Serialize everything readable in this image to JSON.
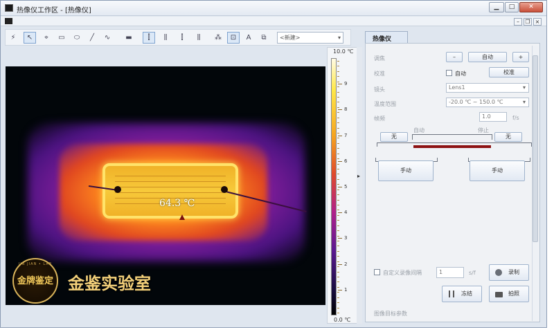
{
  "window": {
    "title": "热像仪工作区 - [热像仪]",
    "minimize": "▁",
    "maximize": "□",
    "close": "✕"
  },
  "mdi": {
    "minimize": "–",
    "restore": "❐",
    "close": "×"
  },
  "toolbar": {
    "tools": [
      {
        "name": "lightning-icon",
        "glyph": "⚡"
      },
      {
        "name": "cursor-icon",
        "glyph": "↖"
      },
      {
        "name": "crosshair-icon",
        "glyph": "⌖"
      },
      {
        "name": "rectangle-icon",
        "glyph": "▭"
      },
      {
        "name": "ellipse-icon",
        "glyph": "⬭"
      },
      {
        "name": "line-icon",
        "glyph": "╱"
      },
      {
        "name": "polyline-icon",
        "glyph": "∿"
      },
      {
        "name": "palette-icon",
        "glyph": "▬"
      },
      {
        "name": "align-left-icon",
        "glyph": "⫿"
      },
      {
        "name": "align-center-icon",
        "glyph": "⫼"
      },
      {
        "name": "align-right-icon",
        "glyph": "⫿"
      },
      {
        "name": "align-justify-icon",
        "glyph": "⫼"
      },
      {
        "name": "auto-range-icon",
        "glyph": "⁂"
      },
      {
        "name": "fit-icon",
        "glyph": "⊡"
      },
      {
        "name": "text-icon",
        "glyph": "A"
      },
      {
        "name": "image-icon",
        "glyph": "⧉"
      }
    ],
    "select_value": "<新建>",
    "select_arrow": "▾"
  },
  "thermal": {
    "spot_temp": "64.3 ℃",
    "seal_text": "金牌鉴定",
    "seal_ring": "JIN JIAN • LAB",
    "watermark": "金鉴实验室"
  },
  "scale": {
    "max": "10.0 ℃",
    "min": "0.0 ℃",
    "ticks": [
      "9",
      "8",
      "7",
      "6",
      "5",
      "4",
      "3",
      "2",
      "1"
    ]
  },
  "panel": {
    "tab": "热像仪",
    "focus_label": "调焦",
    "focus_minus": "–",
    "focus_auto": "自动",
    "focus_plus": "+",
    "calib_label": "校准",
    "calib_auto": "自动",
    "calib_button": "校准",
    "lens_label": "镜头",
    "lens_value": "Lens1",
    "range_label": "温度范围",
    "range_value": "-20.0 ℃ ~ 150.0 ℃",
    "framerate_label": "帧频",
    "framerate_value": "1.0",
    "framerate_unit": "f/s",
    "level_auto": "自动",
    "level_stop": "停止",
    "left_none": "无",
    "right_none": "无",
    "left_manual": "手动",
    "right_manual": "手动",
    "custom_interval_label": "自定义录像间隔",
    "interval_value": "1",
    "interval_unit": "s/f",
    "record_button": "录制",
    "freeze_button": "冻结",
    "snapshot_button": "拍照",
    "image_params_label": "图像目标参数"
  },
  "colors": {
    "accent": "#8d1212",
    "panel_bg": "#f0f2f5"
  }
}
